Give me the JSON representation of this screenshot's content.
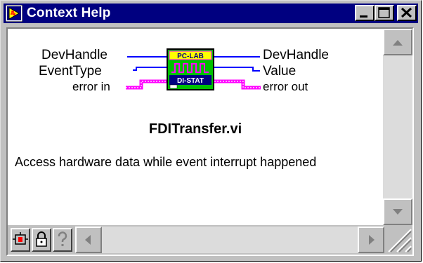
{
  "window": {
    "title": "Context Help"
  },
  "connector": {
    "left_terminals": [
      "DevHandle",
      "EventType",
      "error in"
    ],
    "right_terminals": [
      "DevHandle",
      "Value",
      "error out"
    ],
    "icon_top_text": "PC-LAB",
    "icon_bottom_text": "DI-STAT",
    "colors": {
      "numeric_wire": "#0000ff",
      "error_wire": "#ff00ff",
      "icon_body": "#00c000"
    }
  },
  "vi_name": "FDITransfer.vi",
  "description": "Access hardware data while event interrupt happened",
  "toolbar": {
    "icons": [
      "block-diagram-icon",
      "lock-icon",
      "help-question-icon"
    ]
  }
}
